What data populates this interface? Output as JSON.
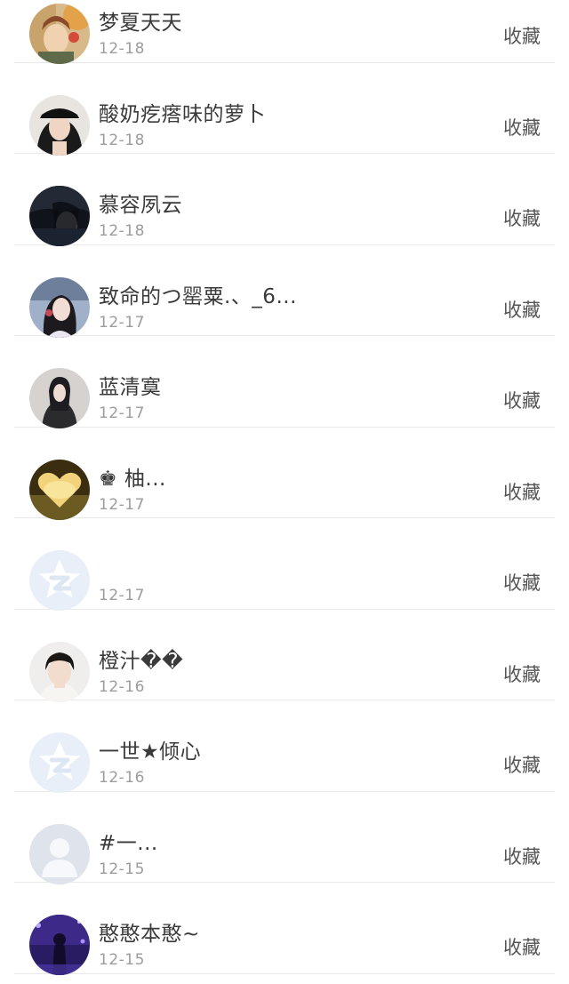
{
  "collect_label": "收藏",
  "items": [
    {
      "name": "梦夏天天",
      "date": "12-18",
      "avatar": "painted-girl"
    },
    {
      "name": "酸奶疙瘩味的萝卜",
      "date": "12-18",
      "avatar": "girl-cap"
    },
    {
      "name": "慕容夙云",
      "date": "12-18",
      "avatar": "dark-hair"
    },
    {
      "name": "致命的つ罂粟.、_6...",
      "date": "12-17",
      "avatar": "girl-long-hair"
    },
    {
      "name": "蓝清寞",
      "date": "12-17",
      "avatar": "girl-dark-coat"
    },
    {
      "name": "♚ 柚...",
      "date": "12-17",
      "avatar": "golden-heart"
    },
    {
      "name": "",
      "date": "12-17",
      "avatar": "qzone-default"
    },
    {
      "name": "橙汁��",
      "date": "12-16",
      "avatar": "boy-portrait"
    },
    {
      "name": "一世★倾心",
      "date": "12-16",
      "avatar": "qzone-default"
    },
    {
      "name": "#一...",
      "date": "12-15",
      "avatar": "default-person"
    },
    {
      "name": "憨憨本憨~",
      "date": "12-15",
      "avatar": "purple-night"
    }
  ]
}
